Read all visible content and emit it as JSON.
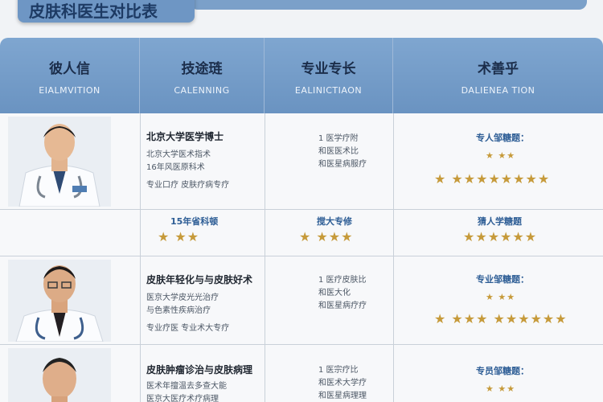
{
  "title": "皮肤科医生对比表",
  "header": {
    "col1": {
      "main": "彼人信",
      "sub": "EIALMVITION"
    },
    "col2": {
      "main": "技途琏",
      "sub": "CALENNING"
    },
    "col3": {
      "main": "专业专长",
      "sub": "EALINICTIAON"
    },
    "col4": {
      "main": "术善乎",
      "sub": "DALIENEA TION"
    }
  },
  "doctors": [
    {
      "title": "北京大学医学博士",
      "lines": [
        "北京大学医术指术",
        "16年风医原科术",
        "专业口疗 皮肤疗病专疗"
      ],
      "specialty": [
        "1 医学疗附",
        "和医医术比",
        "和医星病服疗"
      ],
      "rating_title": "专人邹糖题：",
      "stars_a": "★  ★★",
      "stars_b": "★  ★★★★★★★★"
    },
    {
      "title": "皮肤年轻化与与皮肤好术",
      "lines": [
        "医京大学皮光光治疗",
        "与色素性疾病治疗",
        "专业疗医 专业术大专疗"
      ],
      "specialty": [
        "1 医疗皮肤比",
        "和医大化",
        "和医星病疗疗"
      ],
      "rating_title": "专业邹糖题：",
      "stars_a": "★  ★★",
      "stars_b": "★  ★★★ ★★★★★★"
    },
    {
      "title": "皮肤肿瘤诊治与皮肤病理",
      "lines": [
        "医术年擅温去多查大能",
        "医京大医疗术疗病理"
      ],
      "specialty": [
        "1 医宗疗比",
        "和医术大学疗",
        "和医星病理理"
      ],
      "rating_title": "专员邹糖题：",
      "stars_a": "★  ★★"
    }
  ],
  "midrow": {
    "c2_label": "15年省科顿",
    "c2_stars": "★    ★★",
    "c3_label": "搅大专修",
    "c3_stars": "★    ★★★",
    "c4_label": "猜人学糖题",
    "c4_stars": "★★★★★★"
  },
  "colors": {
    "header": "#7aa1cc",
    "star": "#c69a3a",
    "accent": "#2d5d95"
  }
}
